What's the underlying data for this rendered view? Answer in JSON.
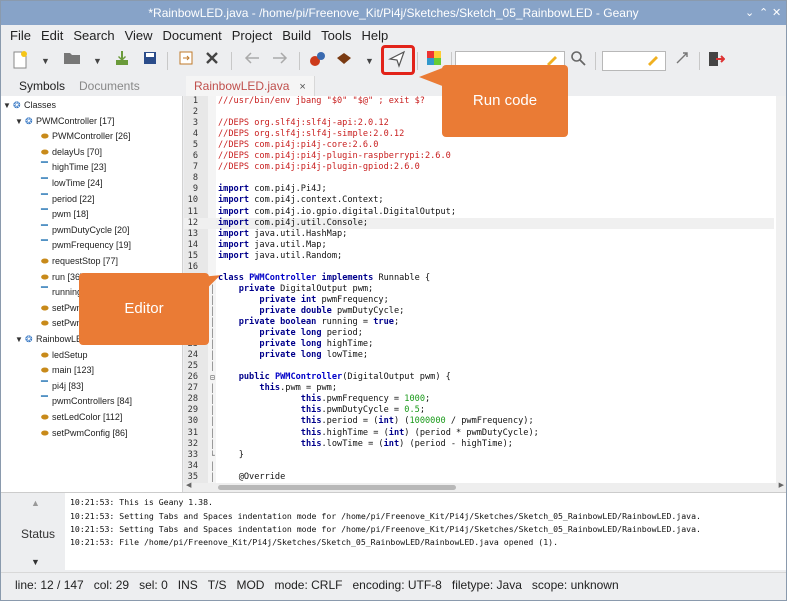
{
  "window": {
    "title": "*RainbowLED.java - /home/pi/Freenove_Kit/Pi4j/Sketches/Sketch_05_RainbowLED - Geany",
    "controls": [
      "⌄",
      "⌃",
      "✕"
    ]
  },
  "menu": [
    "File",
    "Edit",
    "Search",
    "View",
    "Document",
    "Project",
    "Build",
    "Tools",
    "Help"
  ],
  "sidebar": {
    "tabs": [
      "Symbols",
      "Documents"
    ],
    "tree": [
      {
        "label": "Classes",
        "level": 0,
        "kind": "group"
      },
      {
        "label": "PWMController [17]",
        "level": 1,
        "kind": "class"
      },
      {
        "label": "PWMController [26]",
        "level": 2,
        "kind": "method"
      },
      {
        "label": "delayUs [70]",
        "level": 2,
        "kind": "method"
      },
      {
        "label": "highTime [23]",
        "level": 2,
        "kind": "field"
      },
      {
        "label": "lowTime [24]",
        "level": 2,
        "kind": "field"
      },
      {
        "label": "period [22]",
        "level": 2,
        "kind": "field"
      },
      {
        "label": "pwm [18]",
        "level": 2,
        "kind": "field"
      },
      {
        "label": "pwmDutyCycle [20]",
        "level": 2,
        "kind": "field"
      },
      {
        "label": "pwmFrequency [19]",
        "level": 2,
        "kind": "field"
      },
      {
        "label": "requestStop [77]",
        "level": 2,
        "kind": "method"
      },
      {
        "label": "run [36]",
        "level": 2,
        "kind": "method"
      },
      {
        "label": "running",
        "level": 2,
        "kind": "field"
      },
      {
        "label": "setPwm",
        "level": 2,
        "kind": "method"
      },
      {
        "label": "setPwm",
        "level": 2,
        "kind": "method"
      },
      {
        "label": "RainbowLE",
        "level": 1,
        "kind": "class"
      },
      {
        "label": "ledSetup",
        "level": 2,
        "kind": "method"
      },
      {
        "label": "main [123]",
        "level": 2,
        "kind": "method"
      },
      {
        "label": "pi4j [83]",
        "level": 2,
        "kind": "field"
      },
      {
        "label": "pwmControllers [84]",
        "level": 2,
        "kind": "field"
      },
      {
        "label": "setLedColor [112]",
        "level": 2,
        "kind": "method"
      },
      {
        "label": "setPwmConfig [86]",
        "level": 2,
        "kind": "method"
      }
    ]
  },
  "editor": {
    "tab_label": "RainbowLED.java",
    "tab_close": "×",
    "current_line": 12,
    "lines": [
      {
        "n": "1",
        "fold": "",
        "parts": [
          [
            "cm",
            "///usr/bin/env jbang \"$0\" \"$@\" ; exit $?"
          ]
        ]
      },
      {
        "n": "2",
        "fold": "",
        "parts": []
      },
      {
        "n": "3",
        "fold": "",
        "parts": [
          [
            "cm",
            "//DEPS org.slf4j:slf4j-api:2.0.12"
          ]
        ]
      },
      {
        "n": "4",
        "fold": "",
        "parts": [
          [
            "cm",
            "//DEPS org.slf4j:slf4j-simple:2.0.12"
          ]
        ]
      },
      {
        "n": "5",
        "fold": "",
        "parts": [
          [
            "cm",
            "//DEPS com.pi4j:pi4j-core:2.6.0"
          ]
        ]
      },
      {
        "n": "6",
        "fold": "",
        "parts": [
          [
            "cm",
            "//DEPS com.pi4j:pi4j-plugin-raspberrypi:2.6.0"
          ]
        ]
      },
      {
        "n": "7",
        "fold": "",
        "parts": [
          [
            "cm",
            "//DEPS com.pi4j:pi4j-plugin-gpiod:2.6.0"
          ]
        ]
      },
      {
        "n": "8",
        "fold": "",
        "parts": []
      },
      {
        "n": "9",
        "fold": "",
        "parts": [
          [
            "kw",
            "import"
          ],
          [
            "pl",
            " com.pi4j.Pi4J;"
          ]
        ]
      },
      {
        "n": "10",
        "fold": "",
        "parts": [
          [
            "kw",
            "import"
          ],
          [
            "pl",
            " com.pi4j.context.Context;"
          ]
        ]
      },
      {
        "n": "11",
        "fold": "",
        "parts": [
          [
            "kw",
            "import"
          ],
          [
            "pl",
            " com.pi4j.io.gpio.digital.DigitalOutput;"
          ]
        ]
      },
      {
        "n": "12",
        "fold": "",
        "parts": [
          [
            "kw",
            "import"
          ],
          [
            "pl",
            " com.pi4j.util.Console;"
          ]
        ]
      },
      {
        "n": "13",
        "fold": "",
        "parts": [
          [
            "kw",
            "import"
          ],
          [
            "pl",
            " java.util.HashMap;"
          ]
        ]
      },
      {
        "n": "14",
        "fold": "",
        "parts": [
          [
            "kw",
            "import"
          ],
          [
            "pl",
            " java.util.Map;"
          ]
        ]
      },
      {
        "n": "15",
        "fold": "",
        "parts": [
          [
            "kw",
            "import"
          ],
          [
            "pl",
            " java.util.Random;"
          ]
        ]
      },
      {
        "n": "16",
        "fold": "",
        "parts": []
      },
      {
        "n": "17",
        "fold": "⊟",
        "parts": [
          [
            "kw",
            "class"
          ],
          [
            "pl",
            " "
          ],
          [
            "fn",
            "PWMController"
          ],
          [
            "pl",
            " "
          ],
          [
            "kw",
            "implements"
          ],
          [
            "pl",
            " Runnable {"
          ]
        ]
      },
      {
        "n": "18",
        "fold": "│",
        "parts": [
          [
            "pl",
            "    "
          ],
          [
            "kw",
            "private"
          ],
          [
            "pl",
            " DigitalOutput pwm;"
          ]
        ]
      },
      {
        "n": "19",
        "fold": "│",
        "parts": [
          [
            "pl",
            "        "
          ],
          [
            "kw",
            "private"
          ],
          [
            "pl",
            " "
          ],
          [
            "kw",
            "int"
          ],
          [
            "pl",
            " pwmFrequency;"
          ]
        ]
      },
      {
        "n": "20",
        "fold": "│",
        "parts": [
          [
            "pl",
            "        "
          ],
          [
            "kw",
            "private"
          ],
          [
            "pl",
            " "
          ],
          [
            "kw",
            "double"
          ],
          [
            "pl",
            " pwmDutyCycle;"
          ]
        ]
      },
      {
        "n": "21",
        "fold": "│",
        "parts": [
          [
            "pl",
            "    "
          ],
          [
            "kw",
            "private"
          ],
          [
            "pl",
            " "
          ],
          [
            "kw",
            "boolean"
          ],
          [
            "pl",
            " running = "
          ],
          [
            "kw",
            "true"
          ],
          [
            "pl",
            ";"
          ]
        ]
      },
      {
        "n": "22",
        "fold": "│",
        "parts": [
          [
            "pl",
            "        "
          ],
          [
            "kw",
            "private"
          ],
          [
            "pl",
            " "
          ],
          [
            "kw",
            "long"
          ],
          [
            "pl",
            " period;"
          ]
        ]
      },
      {
        "n": "23",
        "fold": "│",
        "parts": [
          [
            "pl",
            "        "
          ],
          [
            "kw",
            "private"
          ],
          [
            "pl",
            " "
          ],
          [
            "kw",
            "long"
          ],
          [
            "pl",
            " highTime;"
          ]
        ]
      },
      {
        "n": "24",
        "fold": "│",
        "parts": [
          [
            "pl",
            "        "
          ],
          [
            "kw",
            "private"
          ],
          [
            "pl",
            " "
          ],
          [
            "kw",
            "long"
          ],
          [
            "pl",
            " lowTime;"
          ]
        ]
      },
      {
        "n": "25",
        "fold": "│",
        "parts": []
      },
      {
        "n": "26",
        "fold": "⊟",
        "parts": [
          [
            "pl",
            "    "
          ],
          [
            "kw",
            "public"
          ],
          [
            "pl",
            " "
          ],
          [
            "fn",
            "PWMController"
          ],
          [
            "pl",
            "(DigitalOutput pwm) {"
          ]
        ]
      },
      {
        "n": "27",
        "fold": "│",
        "parts": [
          [
            "pl",
            "        "
          ],
          [
            "kw",
            "this"
          ],
          [
            "pl",
            ".pwm = pwm;"
          ]
        ]
      },
      {
        "n": "28",
        "fold": "│",
        "parts": [
          [
            "pl",
            "                "
          ],
          [
            "kw",
            "this"
          ],
          [
            "pl",
            ".pwmFrequency = "
          ],
          [
            "lit",
            "1000"
          ],
          [
            "pl",
            ";"
          ]
        ]
      },
      {
        "n": "29",
        "fold": "│",
        "parts": [
          [
            "pl",
            "                "
          ],
          [
            "kw",
            "this"
          ],
          [
            "pl",
            ".pwmDutyCycle = "
          ],
          [
            "lit",
            "0.5"
          ],
          [
            "pl",
            ";"
          ]
        ]
      },
      {
        "n": "30",
        "fold": "│",
        "parts": [
          [
            "pl",
            "                "
          ],
          [
            "kw",
            "this"
          ],
          [
            "pl",
            ".period = ("
          ],
          [
            "kw",
            "int"
          ],
          [
            "pl",
            ") ("
          ],
          [
            "lit",
            "1000000"
          ],
          [
            "pl",
            " / pwmFrequency);"
          ]
        ]
      },
      {
        "n": "31",
        "fold": "│",
        "parts": [
          [
            "pl",
            "                "
          ],
          [
            "kw",
            "this"
          ],
          [
            "pl",
            ".highTime = ("
          ],
          [
            "kw",
            "int"
          ],
          [
            "pl",
            ") (period * pwmDutyCycle);"
          ]
        ]
      },
      {
        "n": "32",
        "fold": "│",
        "parts": [
          [
            "pl",
            "                "
          ],
          [
            "kw",
            "this"
          ],
          [
            "pl",
            ".lowTime = ("
          ],
          [
            "kw",
            "int"
          ],
          [
            "pl",
            ") (period - highTime);"
          ]
        ]
      },
      {
        "n": "33",
        "fold": "└",
        "parts": [
          [
            "pl",
            "    }"
          ]
        ]
      },
      {
        "n": "34",
        "fold": "│",
        "parts": []
      },
      {
        "n": "35",
        "fold": "│",
        "parts": [
          [
            "pl",
            "    @Override"
          ]
        ]
      }
    ]
  },
  "messages": {
    "tab_label": "Status",
    "lines": [
      "10:21:53: This is Geany 1.38.",
      "10:21:53: Setting Tabs and Spaces indentation mode for /home/pi/Freenove_Kit/Pi4j/Sketches/Sketch_05_RainbowLED/RainbowLED.java.",
      "10:21:53: Setting Tabs and Spaces indentation mode for /home/pi/Freenove_Kit/Pi4j/Sketches/Sketch_05_RainbowLED/RainbowLED.java.",
      "10:21:53: File /home/pi/Freenove_Kit/Pi4j/Sketches/Sketch_05_RainbowLED/RainbowLED.java opened (1)."
    ]
  },
  "statusbar": {
    "line": "line: 12 / 147",
    "col": "col: 29",
    "sel": "sel: 0",
    "ins": "INS",
    "ts": "T/S",
    "mod": "MOD",
    "mode": "mode: CRLF",
    "encoding": "encoding: UTF-8",
    "filetype": "filetype: Java",
    "scope": "scope: unknown"
  },
  "annotations": {
    "run_code": "Run code",
    "editor": "Editor",
    "color": "#ea7b35",
    "highlight_color": "#e2231a"
  }
}
